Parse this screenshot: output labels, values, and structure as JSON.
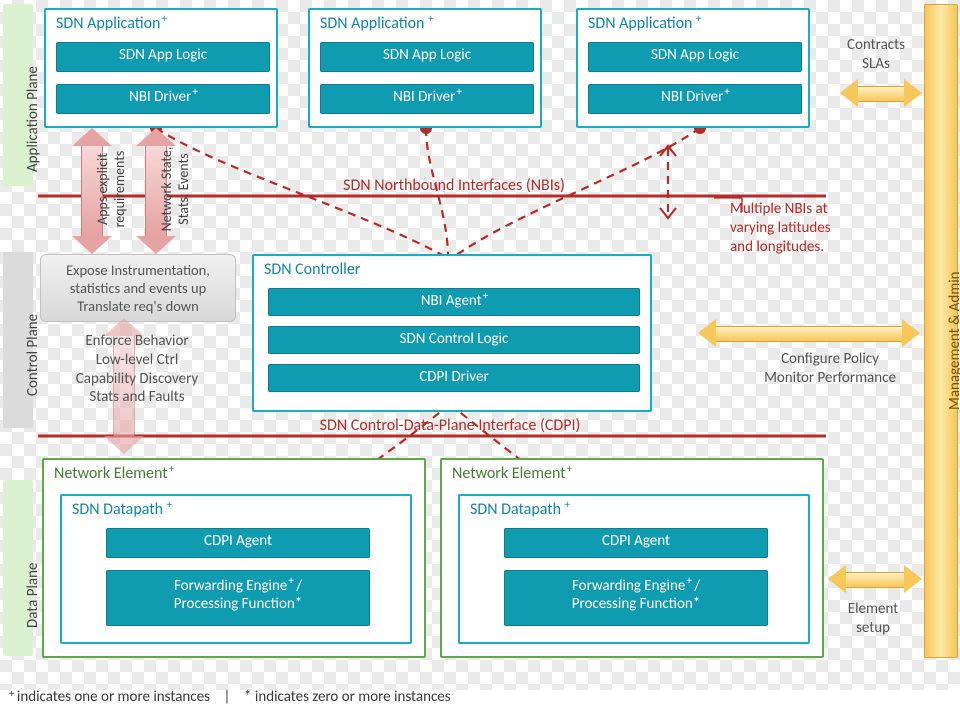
{
  "planes": {
    "app": "Application Plane",
    "ctrl": "Control Plane",
    "data": "Data Plane",
    "mgmt": "Management & Admin"
  },
  "app": {
    "title": "SDN Application",
    "logic": "SDN App Logic",
    "nbi": "NBI Driver"
  },
  "controller": {
    "title": "SDN Controller",
    "agent": "NBI Agent",
    "logic": "SDN Control Logic",
    "driver": "CDPI Driver"
  },
  "netelem": {
    "title": "Network Element",
    "datapath": "SDN Datapath",
    "agent": "CDPI Agent",
    "engine1": "Forwarding Engine",
    "engine2": "Processing Function*"
  },
  "interfaces": {
    "nbi": "SDN Northbound Interfaces (NBIs)",
    "cdpi": "SDN Control-Data-Plane Interface (CDPI)"
  },
  "right_notes": {
    "contracts": "Contracts\nSLAs",
    "nbis": "Multiple NBIs at\nvarying latitudes\nand longitudes.",
    "policy": "Configure Policy\nMonitor Performance",
    "element": "Element\nsetup"
  },
  "left_arrows": {
    "down": "Apps explicit\nrequirements",
    "up": "Network State,\nStats, Events"
  },
  "callout": "Expose Instrumentation,\nstatistics and events up\nTranslate req's down",
  "left_note": "Enforce Behavior\nLow-level Ctrl\nCapability Discovery\nStats and Faults",
  "footer": {
    "plus": "indicates one or more instances",
    "sep": "|",
    "star": "* indicates zero or more instances"
  }
}
